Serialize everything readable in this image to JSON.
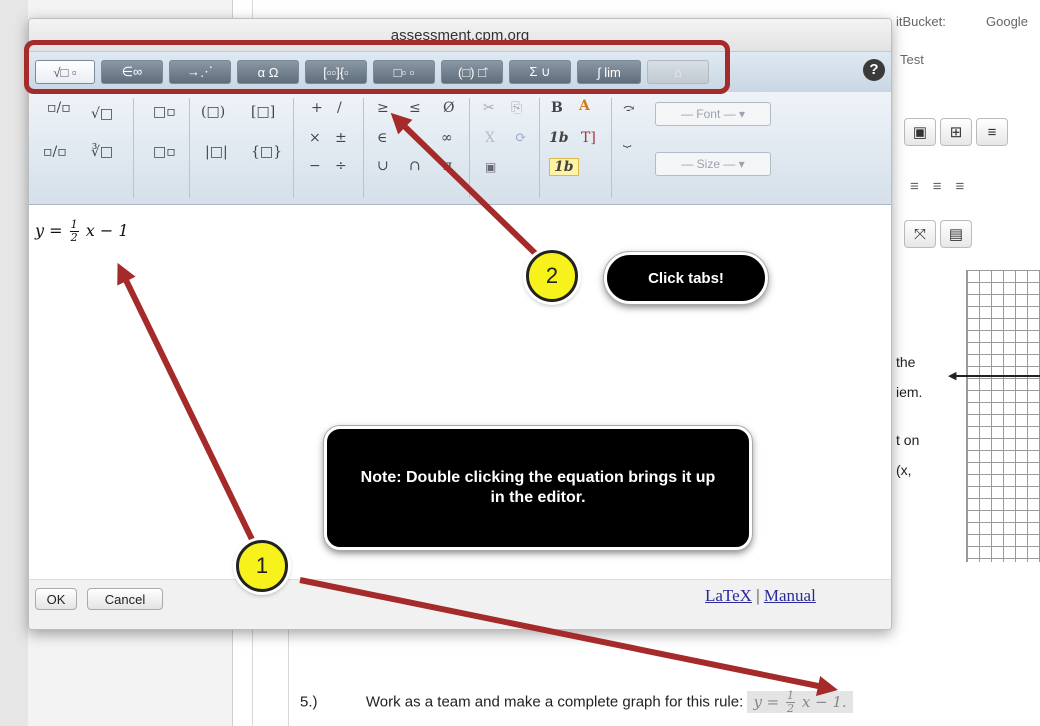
{
  "background": {
    "bookmarks": [
      "itBucket:",
      "Google"
    ],
    "tab_fragment": "Test",
    "text_fragments": [
      "the",
      "iem.",
      "t on",
      "(x,"
    ],
    "question": {
      "number": "5.)",
      "text": "Work as a team and make a complete graph for this rule:",
      "equation_lhs": "y =",
      "equation_num": "1",
      "equation_den": "2",
      "equation_rest": "x − 1."
    }
  },
  "dialog": {
    "title": "assessment.cpm.org",
    "tabs": [
      {
        "label": "√□ ▫",
        "active": true
      },
      {
        "label": "∈∞",
        "active": false
      },
      {
        "label": "→⋰",
        "active": false
      },
      {
        "label": "α Ω",
        "active": false
      },
      {
        "label": "[▫▫]{▫",
        "active": false
      },
      {
        "label": "□▫ ▫",
        "active": false
      },
      {
        "label": "(□) □̂",
        "active": false
      },
      {
        "label": "Σ ∪",
        "active": false
      },
      {
        "label": "∫ lim",
        "active": false
      },
      {
        "label": "⌂",
        "disabled": true
      }
    ],
    "help": "?",
    "symbols": {
      "col1": [
        "▫/▫",
        "▫/▫"
      ],
      "col2": [
        "√□",
        "∛□"
      ],
      "col3": [
        "□▫",
        "□▫"
      ],
      "col4": [
        "(□)",
        "|□|"
      ],
      "col5": [
        "[□]",
        "{□}"
      ],
      "ops": [
        "+",
        "/",
        "×",
        "±",
        "−",
        "÷"
      ],
      "rel": [
        "≥",
        "≤",
        "∈",
        "∞",
        "∪",
        "∩",
        "Ø",
        "π"
      ],
      "edit": [
        "✂",
        "⎘",
        "X",
        "⟳"
      ],
      "fmt": [
        "B",
        "A",
        "1b",
        "T]",
        "1b"
      ],
      "font": "— Font —",
      "size": "— Size —"
    },
    "equation": {
      "lhs": "y =",
      "num": "1",
      "den": "2",
      "rest": "x − 1"
    },
    "ok": "OK",
    "cancel": "Cancel",
    "latex": "LaTeX",
    "link_sep": "|",
    "manual": "Manual"
  },
  "callouts": {
    "one": "1",
    "two": "2",
    "click_tabs": "Click tabs!",
    "note": "Note: Double clicking the equation brings it up in the editor."
  },
  "colors": {
    "arrow": "#a52a2a",
    "circle": "#f7f21c"
  }
}
